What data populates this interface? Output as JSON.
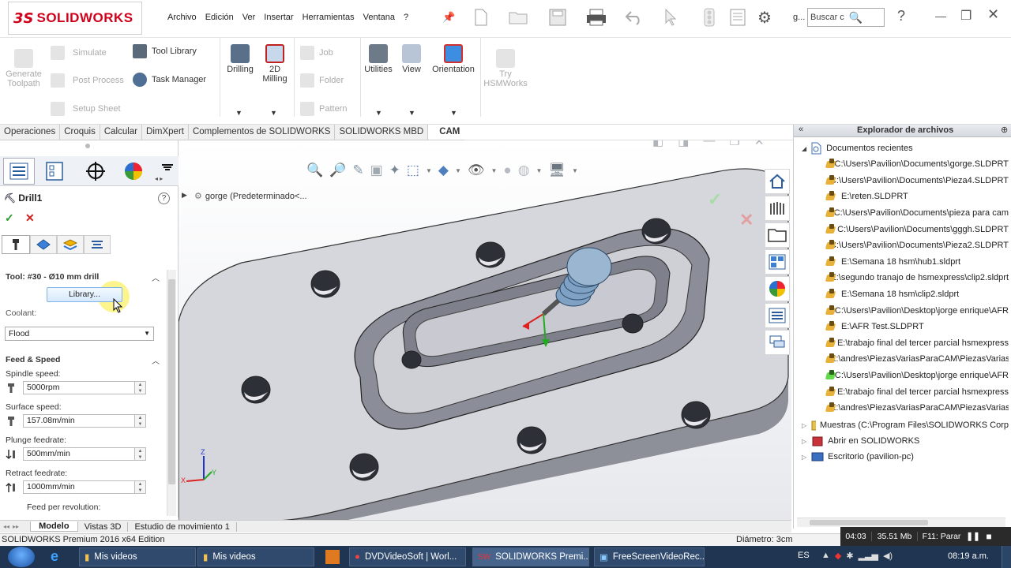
{
  "app": {
    "logo_ds": "3S",
    "logo_text": "SOLIDWORKS"
  },
  "menu": [
    "Archivo",
    "Edición",
    "Ver",
    "Insertar",
    "Herramientas",
    "Ventana",
    "?"
  ],
  "search": {
    "label": "Buscar c",
    "user": "g..."
  },
  "ribbon": {
    "generate_toolpath": "Generate Toolpath",
    "simulate": "Simulate",
    "post_process": "Post Process",
    "setup_sheet": "Setup Sheet",
    "tool_library": "Tool Library",
    "task_manager": "Task Manager",
    "drilling": "Drilling",
    "milling_2d": "2D Milling",
    "job": "Job",
    "folder": "Folder",
    "pattern": "Pattern",
    "utilities": "Utilities",
    "view": "View",
    "orientation": "Orientation",
    "try_hsm": "Try HSMWorks"
  },
  "cmd_tabs": [
    "Operaciones",
    "Croquis",
    "Calcular",
    "DimXpert",
    "Complementos de SOLIDWORKS",
    "SOLIDWORKS MBD",
    "CAM"
  ],
  "active_tab": "CAM",
  "feature": {
    "title": "Drill1",
    "tool_label": "Tool: #30 - Ø10 mm drill",
    "library_button": "Library...",
    "coolant_label": "Coolant:",
    "coolant_value": "Flood",
    "feed_section": "Feed & Speed",
    "spindle_label": "Spindle speed:",
    "spindle_value": "5000rpm",
    "surface_label": "Surface speed:",
    "surface_value": "157.08m/min",
    "plunge_label": "Plunge feedrate:",
    "plunge_value": "500mm/min",
    "retract_label": "Retract feedrate:",
    "retract_value": "1000mm/min",
    "fpr_label": "Feed per revolution:"
  },
  "viewport": {
    "breadcrumb": "gorge  (Predeterminado<..."
  },
  "explorer": {
    "title": "Explorador de archivos",
    "recent_header": "Documentos recientes",
    "recent": [
      "C:\\Users\\Pavilion\\Documents\\gorge.SLDPRT",
      "C:\\Users\\Pavilion\\Documents\\Pieza4.SLDPRT",
      "E:\\reten.SLDPRT",
      "C:\\Users\\Pavilion\\Documents\\pieza para cam",
      "C:\\Users\\Pavilion\\Documents\\gggh.SLDPRT",
      "C:\\Users\\Pavilion\\Documents\\Pieza2.SLDPRT",
      "E:\\Semana 18 hsm\\hub1.sldprt",
      "E:\\segundo tranajo de hsmexpress\\clip2.sldprt",
      "E:\\Semana 18 hsm\\clip2.sldprt",
      "C:\\Users\\Pavilion\\Desktop\\jorge enrique\\AFR",
      "E:\\AFR Test.SLDPRT",
      "E:\\trabajo final del tercer parcial hsmexpress",
      "E:\\andres\\PiezasVariasParaCAM\\PiezasVarias",
      "C:\\Users\\Pavilion\\Desktop\\jorge enrique\\AFR",
      "E:\\trabajo final del tercer parcial hsmexpress",
      "E:\\andres\\PiezasVariasParaCAM\\PiezasVarias"
    ],
    "others": [
      "Muestras (C:\\Program Files\\SOLIDWORKS Corp",
      "Abrir en SOLIDWORKS",
      "Escritorio (pavilion-pc)"
    ]
  },
  "bottom_tabs": [
    "Modelo",
    "Vistas 3D",
    "Estudio de movimiento 1"
  ],
  "status": {
    "left": "SOLIDWORKS Premium 2016 x64 Edition",
    "diameter": "Diámetro: 3cm"
  },
  "recorder": {
    "time": "04:03",
    "size": "35.51 Mb",
    "hint": "F11: Parar"
  },
  "taskbar": {
    "items": [
      "Mis videos",
      "Mis videos",
      "DVDVideoSoft | Worl...",
      "SOLIDWORKS Premi...",
      "FreeScreenVideoRec..."
    ],
    "lang": "ES",
    "clock": "08:19 a.m."
  }
}
